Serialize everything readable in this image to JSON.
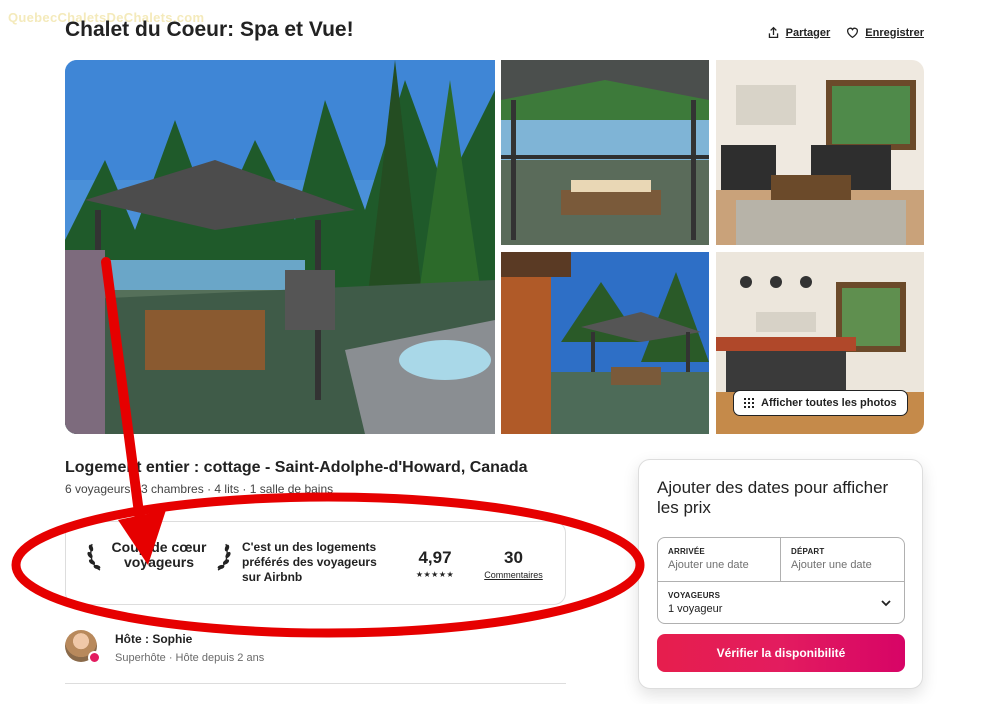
{
  "watermark": "QuebecChaletsDeChalets.com",
  "page_title": "Chalet du Coeur: Spa et Vue!",
  "actions": {
    "share": "Partager",
    "save": "Enregistrer"
  },
  "gallery": {
    "show_all": "Afficher toutes les photos"
  },
  "listing": {
    "title": "Logement entier : cottage - Saint-Adolphe-d'Howard, Canada",
    "details": "6 voyageurs · 3 chambres · 4 lits · 1 salle de bains"
  },
  "favorite": {
    "badge": "Coup de cœur voyageurs",
    "description": "C'est un des logements préférés des voyageurs sur Airbnb",
    "rating": "4,97",
    "stars": "★★★★★",
    "reviews_count": "30",
    "reviews_label": "Commentaires"
  },
  "host": {
    "name": "Hôte : Sophie",
    "subtitle": "Superhôte · Hôte depuis 2 ans"
  },
  "booking": {
    "title": "Ajouter des dates pour afficher les prix",
    "checkin_label": "ARRIVÉE",
    "checkin_placeholder": "Ajouter une date",
    "checkout_label": "DÉPART",
    "checkout_placeholder": "Ajouter une date",
    "guests_label": "VOYAGEURS",
    "guests_value": "1 voyageur",
    "button": "Vérifier la disponibilité"
  },
  "colors": {
    "brand": "#e31c5f",
    "annotation": "#e60000"
  }
}
